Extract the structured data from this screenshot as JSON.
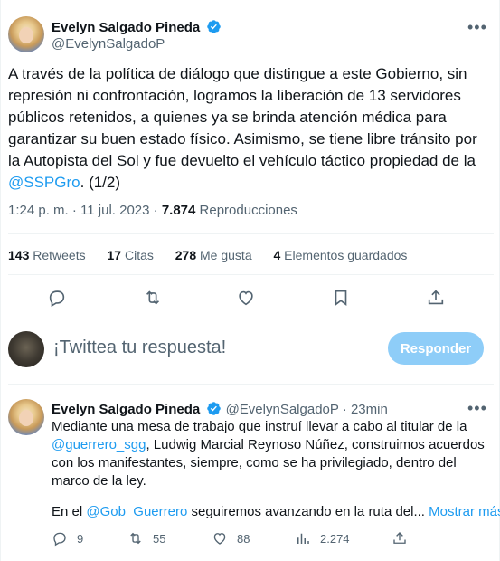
{
  "main_tweet": {
    "name": "Evelyn Salgado Pineda",
    "handle": "@EvelynSalgadoP",
    "text_part1": "A través de la política de diálogo que distingue a este Gobierno, sin represión ni confrontación, logramos la liberación de 13 servidores públicos retenidos, a quienes ya se brinda atención médica para garantizar su buen estado físico. Asimismo, se tiene libre tránsito por la Autopista del Sol y fue devuelto el vehículo táctico propiedad de la ",
    "mention": "@SSPGro",
    "text_part2": ".  (1/2)",
    "time": "1:24 p. m. · 11 jul. 2023 · ",
    "views_count": "7.874",
    "views_label": " Reproducciones",
    "stats": {
      "retweets_count": "143",
      "retweets_label": " Retweets",
      "citas_count": "17",
      "citas_label": " Citas",
      "likes_count": "278",
      "likes_label": " Me gusta",
      "saved_count": "4",
      "saved_label": " Elementos guardados"
    }
  },
  "reply_box": {
    "prompt": "¡Twittea tu respuesta!",
    "button": "Responder"
  },
  "second_tweet": {
    "name": "Evelyn Salgado Pineda",
    "handle": "@EvelynSalgadoP",
    "sep": " · ",
    "time": "23min",
    "para1_a": "Mediante una mesa de trabajo que instruí llevar a cabo al titular de la ",
    "mention1": "@guerrero_sgg",
    "para1_b": ", Ludwig Marcial Reynoso Núñez, construimos acuerdos con los manifestantes, siempre, como se ha privilegiado, dentro del marco de la ley.",
    "para2_a": "En el ",
    "mention2": "@Gob_Guerrero",
    "para2_b": " seguiremos avanzando en la ruta del... ",
    "show_more": "Mostrar más",
    "replies": "9",
    "retweets": "55",
    "likes": "88",
    "views": "2.274"
  },
  "colors": {
    "accent": "#1d9bf0",
    "muted": "#536471",
    "button_disabled": "#8ecdf8"
  }
}
